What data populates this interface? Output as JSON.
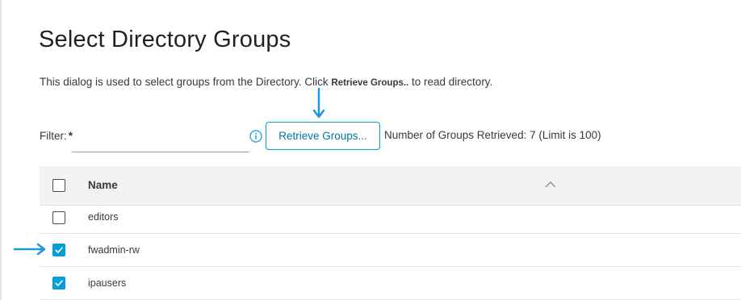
{
  "dialog": {
    "title": "Select Directory Groups",
    "description_prefix": "This dialog is used to select groups from the Directory. Click ",
    "description_strong": "Retrieve Groups..",
    "description_suffix": " to read directory."
  },
  "filter": {
    "label": "Filter:",
    "required_marker": "*",
    "value": ""
  },
  "retrieve_button": {
    "label": "Retrieve Groups..."
  },
  "groups_count_text": "Number of Groups Retrieved: 7 (Limit is 100)",
  "table": {
    "header_name": "Name",
    "header_checked": false,
    "sort": "ascending",
    "rows": [
      {
        "name": "editors",
        "checked": false
      },
      {
        "name": "fwadmin-rw",
        "checked": true
      },
      {
        "name": "ipausers",
        "checked": true
      }
    ]
  },
  "icons": {
    "info": "info-icon",
    "sort": "chevron-up-icon",
    "callout_down": "arrow-down-icon",
    "callout_right": "arrow-right-icon"
  },
  "colors": {
    "accent": "#049fd9",
    "callout_arrow": "#1e96e0",
    "text": "#39393b",
    "header_bg": "#f2f2f2"
  }
}
